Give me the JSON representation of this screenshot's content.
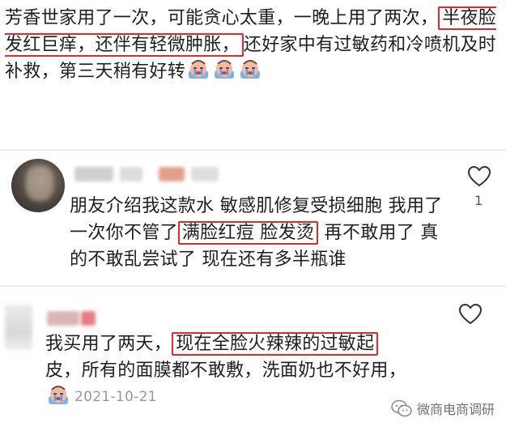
{
  "post": {
    "text_before": "芳香世家用了一次，可能贪心太重，一晚上用了两次，",
    "highlight": "半夜脸发红巨痒，还伴有轻微肿胀，",
    "text_after": "还好家中有过敏药和冷喷机及时补救，第三天稍有好转"
  },
  "comments": [
    {
      "text_before": "朋友介绍我这款水 敏感肌修复受损细胞 我用了一次你不管了",
      "highlight": "满脸红痘 脸发烫",
      "text_after": "再不敢用了 真的不敢乱尝试了 现在还有多半瓶谁",
      "like_count": "1"
    },
    {
      "text_before": "我买用了两天，",
      "highlight": "现在全脸火辣辣的过敏起",
      "text_after": "皮，所有的面膜都不敢敷，洗面奶也不好用，",
      "date": "2021-10-21"
    }
  ],
  "watermark": {
    "text": "微商电商调研"
  },
  "colors": {
    "highlight_border": "#e5282a",
    "text": "#1f1f1f",
    "muted": "#999999"
  },
  "icons": [
    "crying-emoji-icon",
    "heart-outline-icon",
    "wechat-logo-icon"
  ]
}
